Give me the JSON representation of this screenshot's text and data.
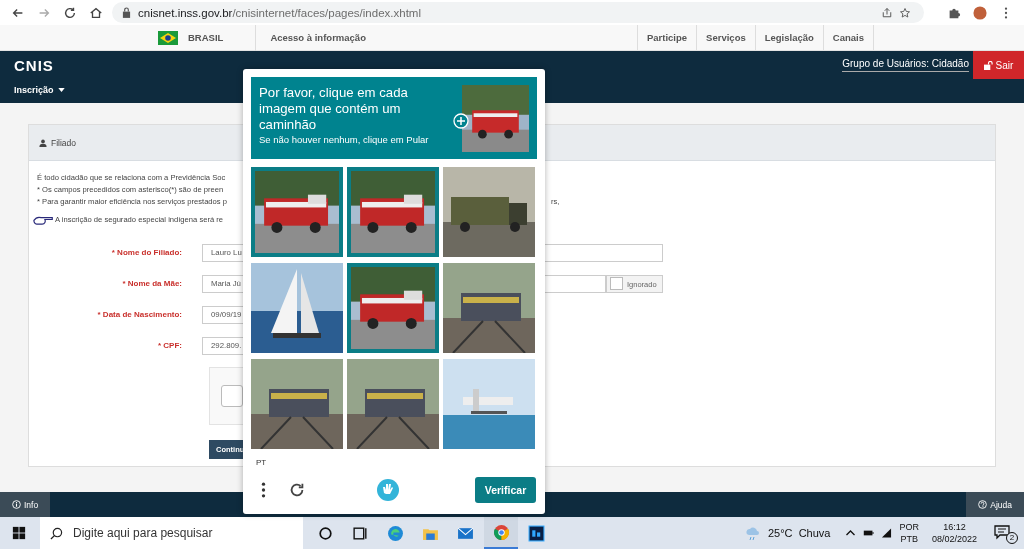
{
  "browser": {
    "url_host": "cnisnet.inss.gov.br",
    "url_path": "/cnisinternet/faces/pages/index.xhtml"
  },
  "gov_bar": {
    "country": "BRASIL",
    "access": "Acesso à informação",
    "links": [
      "Participe",
      "Serviços",
      "Legislação",
      "Canais"
    ]
  },
  "header": {
    "logo": "CNIS",
    "user_group": "Grupo de Usuários: Cidadão",
    "logout": "Sair",
    "menu": "Inscrição"
  },
  "panel": {
    "title": "Filiado",
    "lines": [
      "É todo cidadão que se relaciona com a Previdência Soc",
      "* Os campos precedidos com asterisco(*) são de preen",
      "* Para garantir maior eficiência nos serviços prestados p"
    ],
    "line_tail": "rs,",
    "notice": "A inscrição de segurado especial indígena será re",
    "fields": [
      {
        "label": "* Nome do Filiado:",
        "value": "Lauro Lu",
        "kind": "long"
      },
      {
        "label": "* Nome da Mãe:",
        "value": "Maria Jú",
        "kind": "ignorable",
        "option": "Ignorado",
        "checked": false
      },
      {
        "label": "* Data de Nascimento:",
        "value": "09/09/19",
        "kind": "short"
      },
      {
        "label": "* CPF:",
        "value": "292.809.",
        "kind": "short"
      }
    ],
    "robot_check": {
      "checked": false
    },
    "continue": "Continu"
  },
  "footer": {
    "info": "Info",
    "help": "Ajuda"
  },
  "captcha": {
    "prompt": "Por favor, clique em cada imagem que contém um caminhão",
    "hint": "Se não houver nenhum, clique em Pular",
    "tiles": [
      {
        "selected": true
      },
      {
        "selected": true
      },
      {
        "selected": false
      },
      {
        "selected": false
      },
      {
        "selected": true
      },
      {
        "selected": false
      },
      {
        "selected": false
      },
      {
        "selected": false
      },
      {
        "selected": false
      }
    ],
    "language": "PT",
    "verify": "Verificar"
  },
  "taskbar": {
    "search": "Digite aqui para pesquisar",
    "weather": "25°C  Chuva",
    "lang_top": "POR",
    "lang_bottom": "PTB",
    "time": "16:12",
    "date": "08/02/2022",
    "notifications": "2"
  }
}
